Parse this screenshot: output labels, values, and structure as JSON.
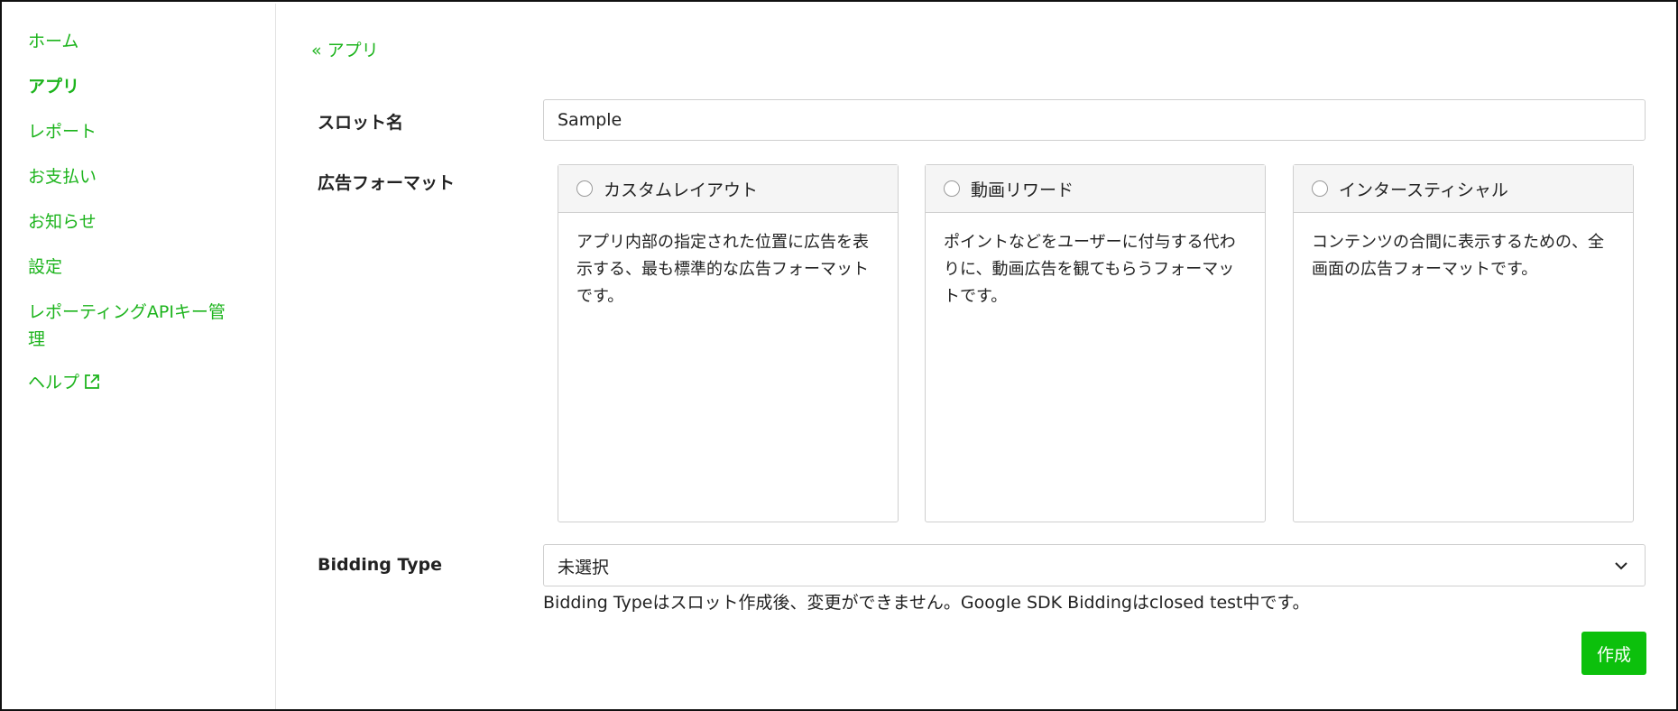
{
  "sidebar": {
    "items": [
      {
        "label": "ホーム"
      },
      {
        "label": "アプリ",
        "active": true
      },
      {
        "label": "レポート"
      },
      {
        "label": "お支払い"
      },
      {
        "label": "お知らせ"
      },
      {
        "label": "設定"
      },
      {
        "label": "レポーティングAPIキー管理"
      },
      {
        "label": "ヘルプ",
        "icon": "external-link-icon"
      }
    ]
  },
  "breadcrumb": {
    "back_label": "« アプリ"
  },
  "form": {
    "slot_name": {
      "label": "スロット名",
      "value": "Sample"
    },
    "ad_format": {
      "label": "広告フォーマット",
      "options": [
        {
          "title": "カスタムレイアウト",
          "description": "アプリ内部の指定された位置に広告を表示する、最も標準的な広告フォーマットです。",
          "selected": false
        },
        {
          "title": "動画リワード",
          "description": "ポイントなどをユーザーに付与する代わりに、動画広告を観てもらうフォーマットです。",
          "selected": false
        },
        {
          "title": "インタースティシャル",
          "description": "コンテンツの合間に表示するための、全画面の広告フォーマットです。",
          "selected": false
        }
      ]
    },
    "bidding_type": {
      "label": "Bidding Type",
      "value": "未選択",
      "help": "Bidding Typeはスロット作成後、変更ができません。Google SDK Biddingはclosed test中です。"
    },
    "submit_label": "作成"
  },
  "colors": {
    "accent": "#1db41d",
    "button": "#0cc00c",
    "border": "#cfcfcf",
    "card_header": "#f5f5f5"
  }
}
